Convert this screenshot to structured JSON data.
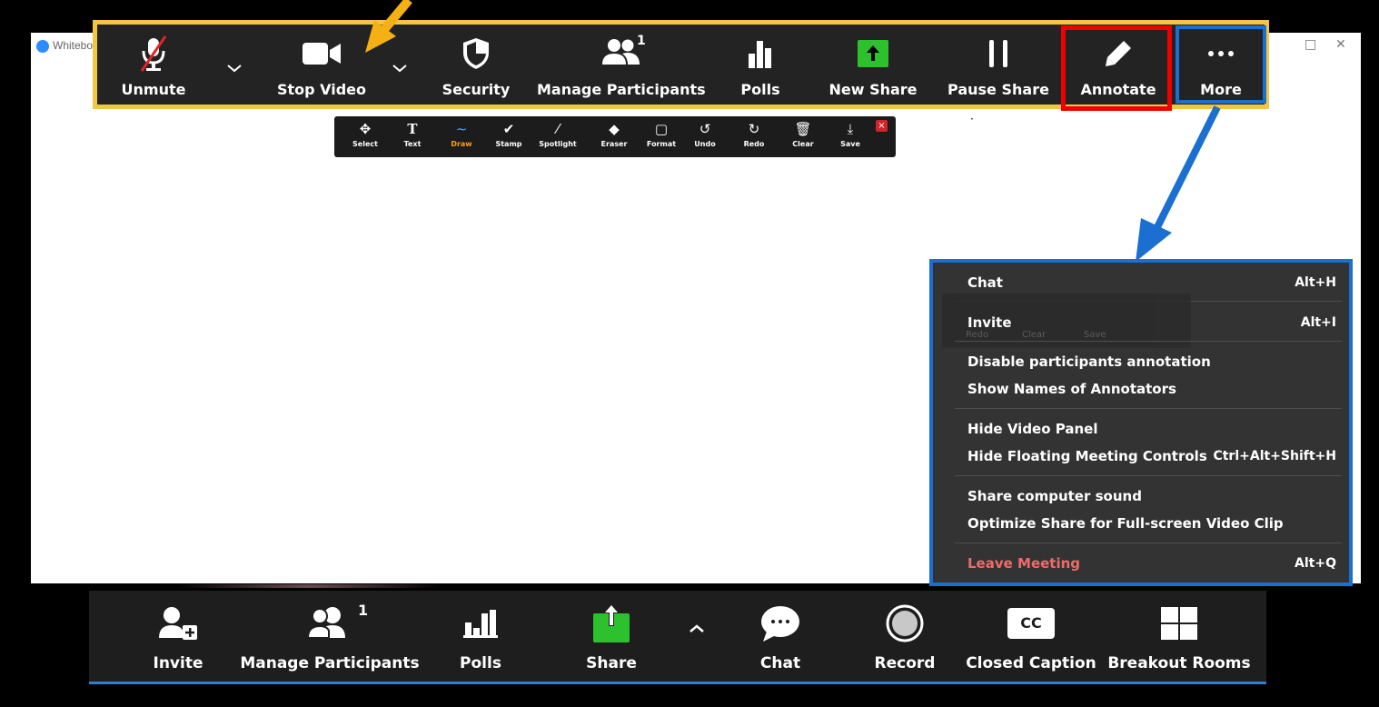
{
  "window": {
    "title": "Whitebo"
  },
  "top_toolbar": {
    "unmute": "Unmute",
    "stop_video": "Stop Video",
    "security": "Security",
    "manage_participants": "Manage Participants",
    "participant_count": "1",
    "polls": "Polls",
    "new_share": "New Share",
    "pause_share": "Pause Share",
    "annotate": "Annotate",
    "more": "More"
  },
  "annotation_toolbar": {
    "items": [
      {
        "label": "Select",
        "icon": "move-icon"
      },
      {
        "label": "Text",
        "icon": "text-icon"
      },
      {
        "label": "Draw",
        "icon": "draw-icon"
      },
      {
        "label": "Stamp",
        "icon": "checkmark-icon"
      },
      {
        "label": "Spotlight",
        "icon": "spotlight-icon"
      },
      {
        "label": "Eraser",
        "icon": "eraser-icon"
      },
      {
        "label": "Format",
        "icon": "format-icon"
      },
      {
        "label": "Undo",
        "icon": "undo-icon"
      },
      {
        "label": "Redo",
        "icon": "redo-icon"
      },
      {
        "label": "Clear",
        "icon": "trash-icon"
      },
      {
        "label": "Save",
        "icon": "save-icon"
      }
    ],
    "close": "×"
  },
  "ghost_toolbar": {
    "redo": "Redo",
    "clear": "Clear",
    "save": "Save"
  },
  "more_menu": {
    "chat": {
      "label": "Chat",
      "shortcut": "Alt+H"
    },
    "invite": {
      "label": "Invite",
      "shortcut": "Alt+I"
    },
    "disable_annotation": {
      "label": "Disable participants annotation"
    },
    "show_names": {
      "label": "Show Names of Annotators"
    },
    "hide_video": {
      "label": "Hide Video Panel"
    },
    "hide_controls": {
      "label": "Hide Floating Meeting Controls",
      "shortcut": "Ctrl+Alt+Shift+H"
    },
    "share_sound": {
      "label": "Share computer sound"
    },
    "optimize": {
      "label": "Optimize Share for Full-screen Video Clip"
    },
    "leave": {
      "label": "Leave Meeting",
      "shortcut": "Alt+Q"
    }
  },
  "bottom_toolbar": {
    "invite": "Invite",
    "manage_participants": "Manage Participants",
    "participant_count": "1",
    "polls": "Polls",
    "share": "Share",
    "chat": "Chat",
    "record": "Record",
    "closed_caption": "Closed Caption",
    "cc_badge": "CC",
    "breakout_rooms": "Breakout Rooms"
  },
  "colors": {
    "highlight_yellow": "#f3c543",
    "highlight_red": "#ee0000",
    "highlight_blue": "#1a6fd1",
    "share_green": "#2ec12e",
    "draw_orange": "#ff9d1a",
    "leave_red": "#f06a6a"
  }
}
